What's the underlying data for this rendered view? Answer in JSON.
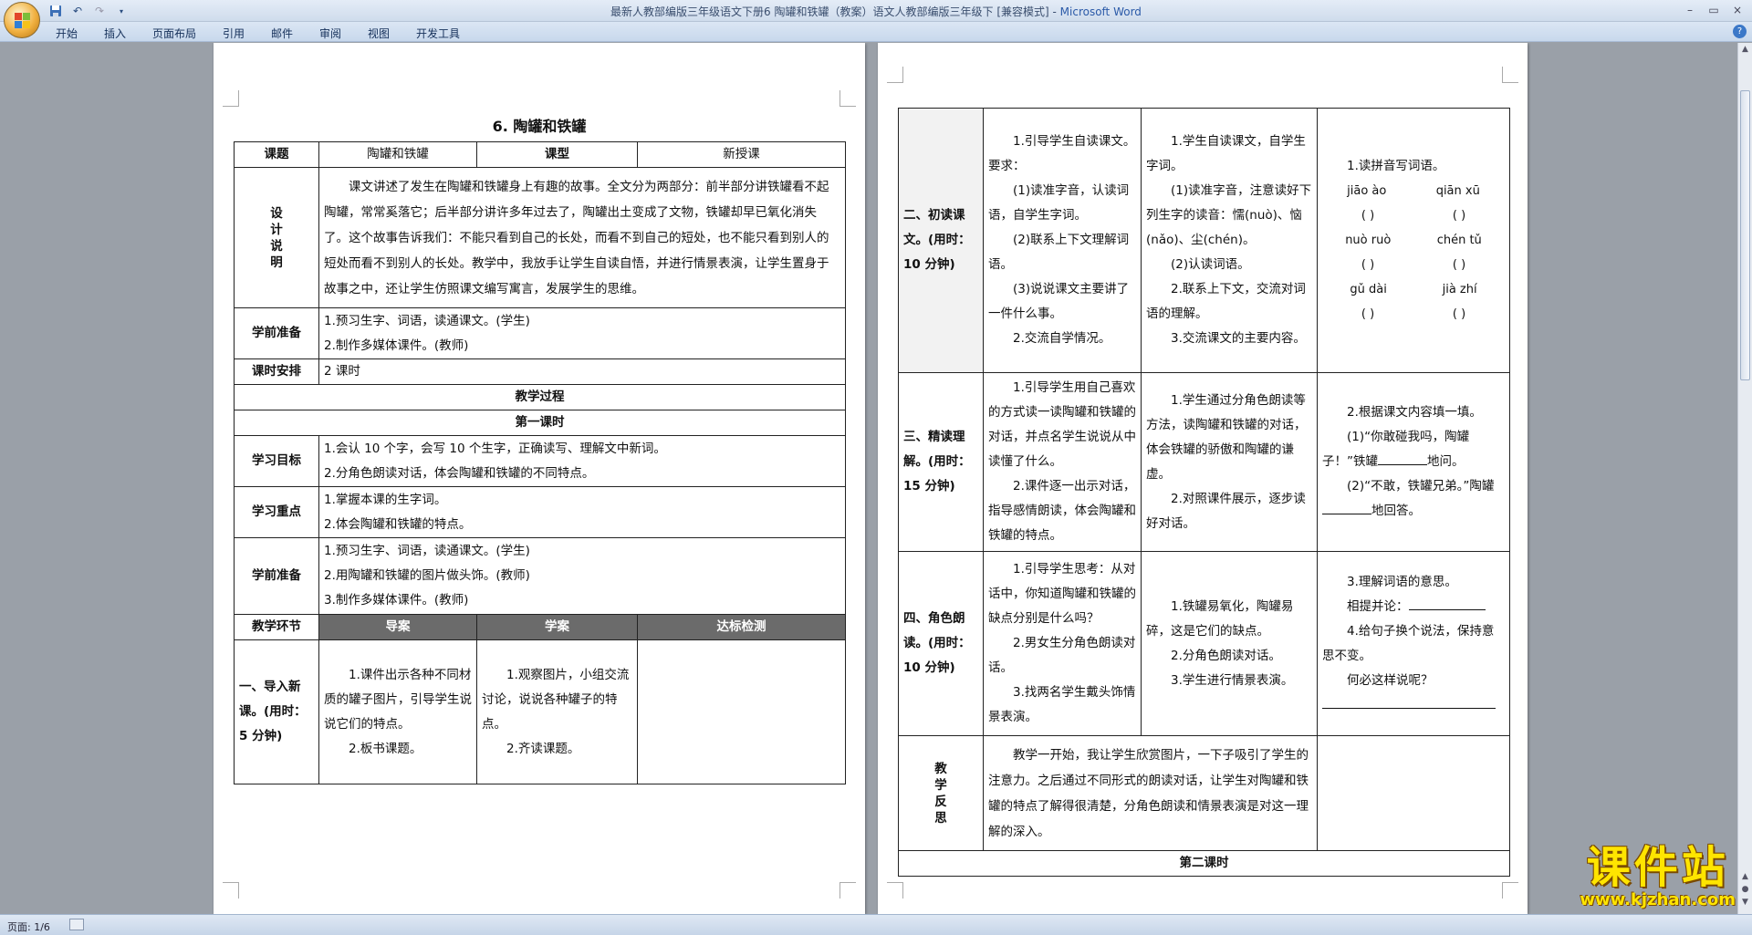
{
  "window": {
    "title": "最新人教部编版三年级语文下册6 陶罐和铁罐（教案）语文人教部编版三年级下 [兼容模式]",
    "app_name": "Microsoft Word",
    "controls": [
      "–",
      "▭",
      "×"
    ]
  },
  "ribbon": {
    "tabs": [
      "开始",
      "插入",
      "页面布局",
      "引用",
      "邮件",
      "审阅",
      "视图",
      "开发工具"
    ]
  },
  "quick_access": [
    "save-icon",
    "undo-icon",
    "redo-icon",
    "customize-icon"
  ],
  "doc": {
    "title": "6. 陶罐和铁罐",
    "header_row": {
      "l1": "课题",
      "v1": "陶罐和铁罐",
      "l2": "课型",
      "v2": "新授课"
    },
    "design": {
      "label": "设计说明",
      "text": "课文讲述了发生在陶罐和铁罐身上有趣的故事。全文分为两部分：前半部分讲铁罐看不起陶罐，常常奚落它；后半部分讲许多年过去了，陶罐出土变成了文物，铁罐却早已氧化消失了。这个故事告诉我们：不能只看到自己的长处，而看不到自己的短处，也不能只看到别人的短处而看不到别人的长处。教学中，我放手让学生自读自悟，并进行情景表演，让学生置身于故事之中，还让学生仿照课文编写寓言，发展学生的思维。"
    },
    "prep1": {
      "label": "学前准备",
      "l1": "1.预习生字、词语，读通课文。(学生)",
      "l2": "2.制作多媒体课件。(教师)"
    },
    "schedule": {
      "label": "课时安排",
      "value": "2 课时"
    },
    "process": "教学过程",
    "lesson1": "第一课时",
    "goals": {
      "label": "学习目标",
      "l1": "1.会认 10 个字，会写 10 个生字，正确读写、理解文中新词。",
      "l2": "2.分角色朗读对话，体会陶罐和铁罐的不同特点。"
    },
    "focus": {
      "label": "学习重点",
      "l1": "1.掌握本课的生字词。",
      "l2": "2.体会陶罐和铁罐的特点。"
    },
    "prep2": {
      "label": "学前准备",
      "l1": "1.预习生字、词语，读通课文。(学生)",
      "l2": "2.用陶罐和铁罐的图片做头饰。(教师)",
      "l3": "3.制作多媒体课件。(教师)"
    },
    "section_head": {
      "l0": "教学环节",
      "l1": "导案",
      "l2": "学案",
      "l3": "达标检测"
    },
    "step1": {
      "label": "一、导入新课。(用时：5 分钟)",
      "guide_1": "1.课件出示各种不同材质的罐子图片，引导学生说说它们的特点。",
      "guide_2": "2.板书课题。",
      "study_1": "1.观察图片，小组交流讨论，说说各种罐子的特点。",
      "study_2": "2.齐读课题。"
    },
    "step2": {
      "label": "二、初读课文。(用时：10 分钟)",
      "guide_1": "1.引导学生自读课文。要求：",
      "guide_2": "(1)读准字音，认读词语，自学生字词。",
      "guide_3": "(2)联系上下文理解词语。",
      "guide_4": "(3)说说课文主要讲了一件什么事。",
      "guide_5": "2.交流自学情况。",
      "study_1": "1.学生自读课文，自学生字词。",
      "study_2": "(1)读准字音，注意读好下列生字的读音：懦(nuò)、恼(nǎo)、尘(chén)。",
      "study_3": "(2)认读词语。",
      "study_4": "2.联系上下文，交流对词语的理解。",
      "study_5": "3.交流课文的主要内容。",
      "check_title": "1.读拼音写词语。",
      "pinyin": [
        "jiāo ào",
        "qiān xū",
        "nuò ruò",
        "chén tǔ",
        "gǔ dài",
        "jià zhí"
      ],
      "bracket": "(        )"
    },
    "step3": {
      "label": "三、精读理解。(用时：15 分钟)",
      "guide_1": "1.引导学生用自己喜欢的方式读一读陶罐和铁罐的对话，并点名学生说说从中读懂了什么。",
      "guide_2": "2.课件逐一出示对话，指导感情朗读，体会陶罐和铁罐的特点。",
      "study_1": "1.学生通过分角色朗读等方法，读陶罐和铁罐的对话，体会铁罐的骄傲和陶罐的谦虚。",
      "study_2": "2.对照课件展示，逐步读好对话。",
      "check_1": "2.根据课文内容填一填。",
      "check_2a": "(1)“你敢碰我吗，陶罐子！”铁罐",
      "check_2b": "地问。",
      "check_3a": "(2)“不敢，铁罐兄弟。”陶罐",
      "check_3b": "地回答。"
    },
    "step4": {
      "label": "四、角色朗读。(用时：10 分钟)",
      "guide_1": "1.引导学生思考：从对话中，你知道陶罐和铁罐的缺点分别是什么吗？",
      "guide_2": "2.男女生分角色朗读对话。",
      "guide_3": "3.找两名学生戴头饰情景表演。",
      "study_1": "1.铁罐易氧化，陶罐易碎，这是它们的缺点。",
      "study_2": "2.分角色朗读对话。",
      "study_3": "3.学生进行情景表演。",
      "check_1": "3.理解词语的意思。",
      "check_2": "相提并论：",
      "check_3": "4.给句子换个说法，保持意思不变。",
      "check_4": "何必这样说呢？"
    },
    "reflect": {
      "label": "教学反思",
      "text": "教学一开始，我让学生欣赏图片，一下子吸引了学生的注意力。之后通过不同形式的朗读对话，让学生对陶罐和铁罐的特点了解得很清楚，分角色朗读和情景表演是对这一理解的深入。"
    },
    "lesson2": "第二课时"
  },
  "status": {
    "page": "页面: 1/6"
  },
  "watermark": {
    "text": "课件站",
    "url": "www.kjzhan.com"
  }
}
